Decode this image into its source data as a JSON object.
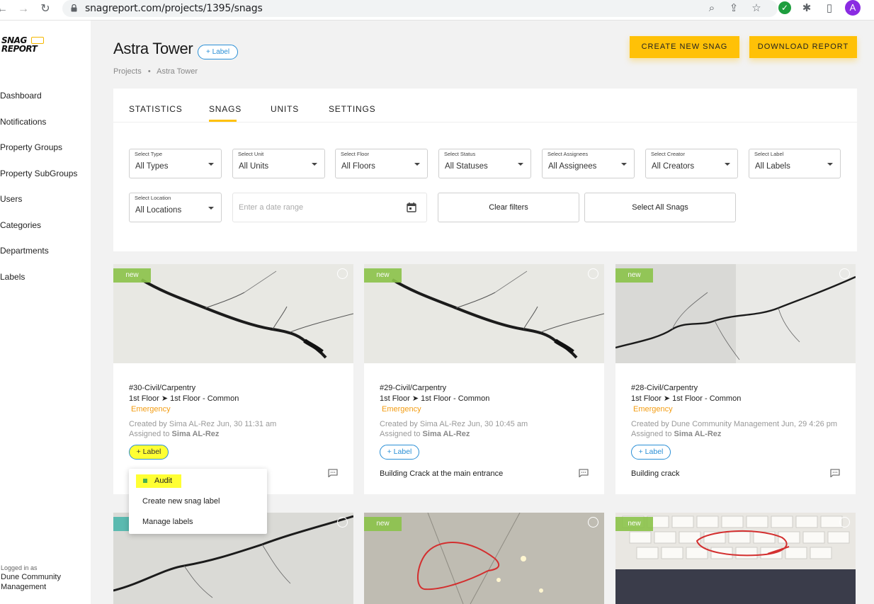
{
  "browser": {
    "url": "snagreport.com/projects/1395/snags",
    "avatar_letter": "A"
  },
  "app": {
    "logo_line1": "SNAG",
    "logo_line2": "REPORT"
  },
  "sidebar": {
    "items": [
      {
        "label": "Dashboard"
      },
      {
        "label": "Notifications"
      },
      {
        "label": "Property Groups"
      },
      {
        "label": "Property SubGroups"
      },
      {
        "label": "Users"
      },
      {
        "label": "Categories"
      },
      {
        "label": "Departments"
      },
      {
        "label": "Labels"
      }
    ],
    "logged_in_caption": "Logged in as",
    "logged_in_name": "Dune Community Management"
  },
  "header": {
    "title": "Astra Tower",
    "label_button": "+ Label",
    "breadcrumb": [
      "Projects",
      "•",
      "Astra Tower"
    ],
    "create_button": "CREATE NEW SNAG",
    "download_button": "DOWNLOAD REPORT"
  },
  "tabs": [
    {
      "label": "STATISTICS",
      "active": false
    },
    {
      "label": "SNAGS",
      "active": true
    },
    {
      "label": "UNITS",
      "active": false
    },
    {
      "label": "SETTINGS",
      "active": false
    }
  ],
  "filters": {
    "type": {
      "label": "Select Type",
      "value": "All Types"
    },
    "unit": {
      "label": "Select Unit",
      "value": "All Units"
    },
    "floor": {
      "label": "Select Floor",
      "value": "All Floors"
    },
    "status": {
      "label": "Select Status",
      "value": "All Statuses"
    },
    "assignees": {
      "label": "Select Assignees",
      "value": "All Assignees"
    },
    "creator": {
      "label": "Select Creator",
      "value": "All Creators"
    },
    "label": {
      "label": "Select Label",
      "value": "All Labels"
    },
    "location": {
      "label": "Select Location",
      "value": "All Locations"
    },
    "date_placeholder": "Enter a date range",
    "clear_button": "Clear filters",
    "select_all_button": "Select All Snags"
  },
  "snags": [
    {
      "badge": "new",
      "title": "#30-Civil/Carpentry",
      "floor": "1st Floor ➤ 1st Floor - Common",
      "priority": "Emergency",
      "created": "Created by Sima AL-Rez Jun, 30 11:31 am",
      "assigned_prefix": "Assigned to",
      "assigned_name": "Sima AL-Rez",
      "label_button": "+ Label",
      "description": ""
    },
    {
      "badge": "new",
      "title": "#29-Civil/Carpentry",
      "floor": "1st Floor ➤ 1st Floor - Common",
      "priority": "Emergency",
      "created": "Created by Sima AL-Rez Jun, 30 10:45 am",
      "assigned_prefix": "Assigned to",
      "assigned_name": "Sima AL-Rez",
      "label_button": "+ Label",
      "description": "Building Crack at the main entrance"
    },
    {
      "badge": "new",
      "title": "#28-Civil/Carpentry",
      "floor": "1st Floor ➤ 1st Floor - Common",
      "priority": "Emergency",
      "created": "Created by Dune Community Management Jun, 29 4:26 pm",
      "assigned_prefix": "Assigned to",
      "assigned_name": "Sima AL-Rez",
      "label_button": "+ Label",
      "description": "Building crack"
    },
    {
      "badge": "new"
    },
    {
      "badge": "new"
    }
  ],
  "label_menu": {
    "items": [
      "Audit",
      "Create new snag label",
      "Manage labels"
    ],
    "audit_color": "#4caf50"
  },
  "colors": {
    "accent": "#ffc107",
    "link": "#2a8fd6",
    "priority": "#f39c12",
    "badge_new": "#8bc34a"
  }
}
